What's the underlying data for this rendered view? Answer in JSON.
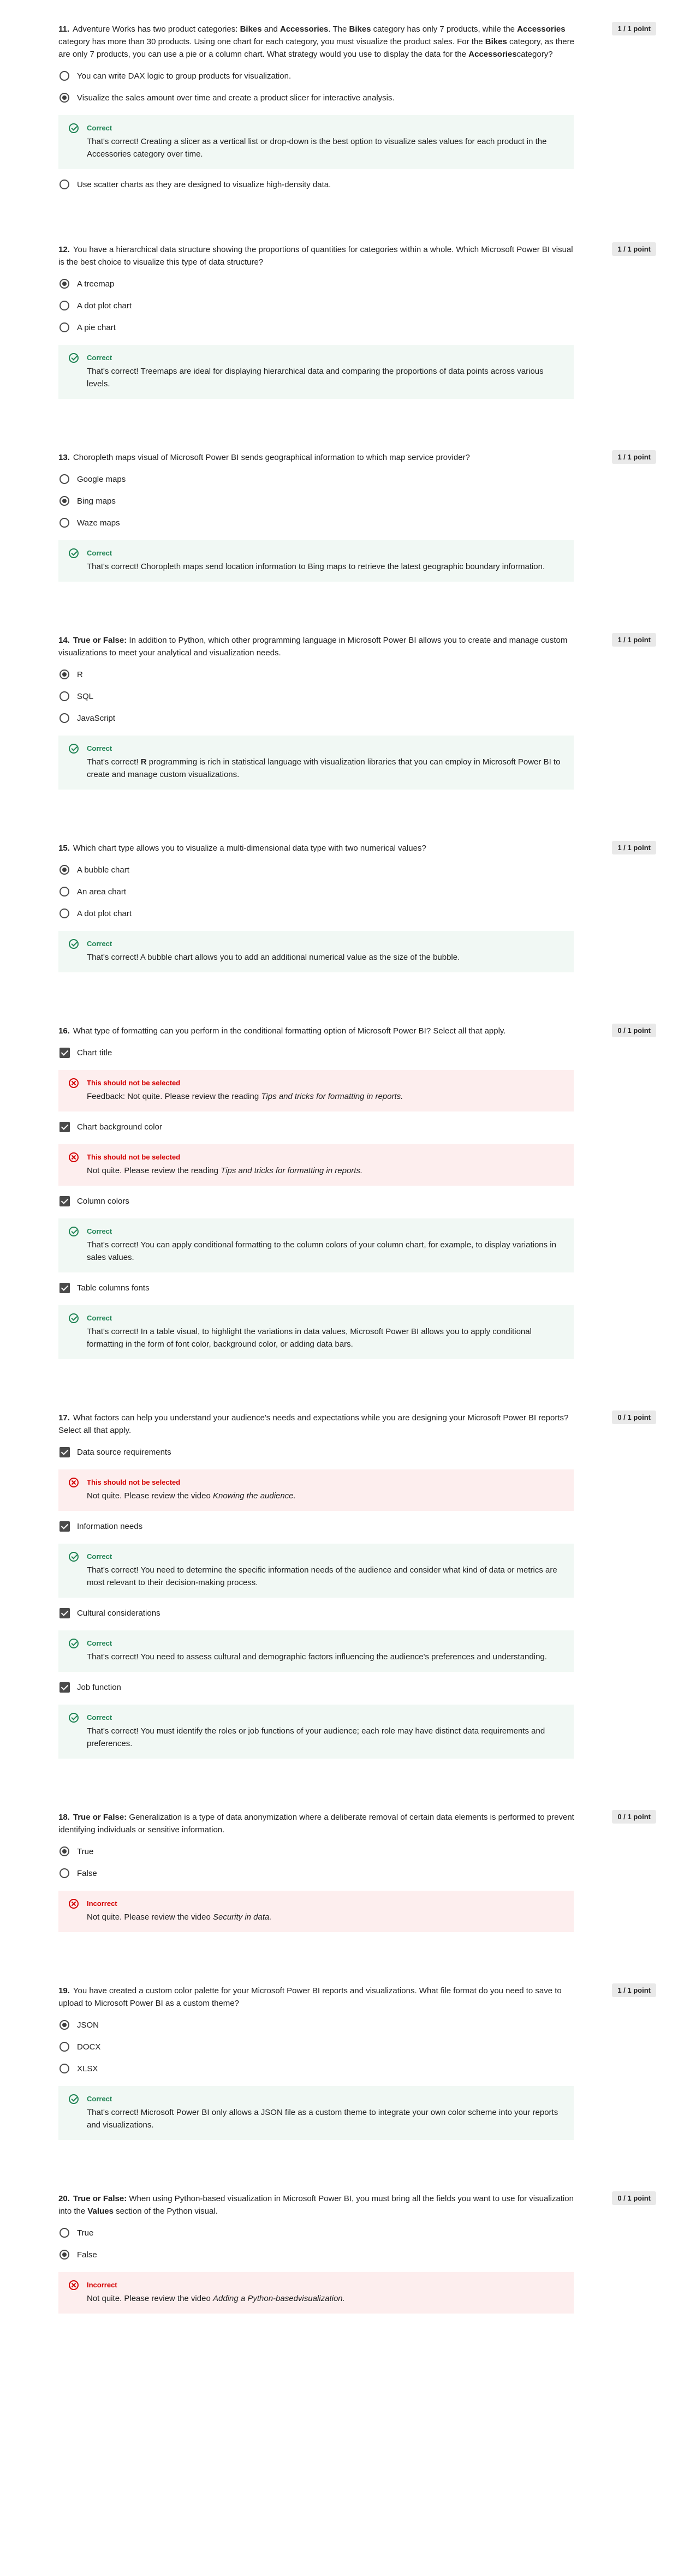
{
  "questions": [
    {
      "number": "11.",
      "points": "1 / 1 point",
      "text_html": "Adventure Works has two product categories: <b>Bikes</b> and <b>Accessories</b>. The <b>Bikes</b> category has only 7 products, while the <b>Accessories</b> category has more than 30 products. Using one chart for each category, you must visualize the product sales. For the <b>Bikes</b> category, as there are only 7 products, you can use a pie or a column chart. What strategy would you use to display the data for the <b>Accessories</b>category?",
      "type": "radio",
      "options": [
        {
          "label": "You can write DAX logic to group products for visualization.",
          "selected": false
        },
        {
          "label": "Visualize the sales amount over time and create a product slicer for interactive analysis.",
          "selected": true,
          "feedback": {
            "kind": "ok",
            "title": "Correct",
            "text_html": "That's correct! Creating a slicer as a vertical list or drop-down is the best option to visualize sales values for each product in the Accessories category over time."
          }
        },
        {
          "label": "Use scatter charts as they are designed to visualize high-density data.",
          "selected": false
        }
      ]
    },
    {
      "number": "12.",
      "points": "1 / 1 point",
      "text_html": "You have a hierarchical data structure showing the proportions of quantities for categories within a whole. Which Microsoft Power BI visual is the best choice to visualize this type of data structure?",
      "type": "radio",
      "options": [
        {
          "label": "A treemap",
          "selected": true
        },
        {
          "label": "A dot plot chart",
          "selected": false
        },
        {
          "label": "A pie chart",
          "selected": false,
          "feedback": {
            "kind": "ok",
            "title": "Correct",
            "text_html": "That's correct! Treemaps are ideal for displaying hierarchical data and comparing the proportions of data points across various levels."
          }
        }
      ]
    },
    {
      "number": "13.",
      "points": "1 / 1 point",
      "text_html": "Choropleth maps visual of Microsoft Power BI sends geographical information to which map service provider?",
      "type": "radio",
      "options": [
        {
          "label": "Google maps",
          "selected": false
        },
        {
          "label": "Bing maps",
          "selected": true
        },
        {
          "label": "Waze maps",
          "selected": false,
          "feedback": {
            "kind": "ok",
            "title": "Correct",
            "text_html": "That's correct! Choropleth maps send location information to Bing maps to retrieve the latest geographic boundary information."
          }
        }
      ]
    },
    {
      "number": "14.",
      "points": "1 / 1 point",
      "text_html": "<b>True or False:</b> In addition to Python, which other programming language in Microsoft Power BI allows you to create and manage custom visualizations to meet your analytical and visualization needs.",
      "type": "radio",
      "options": [
        {
          "label": "R",
          "selected": true
        },
        {
          "label": "SQL",
          "selected": false
        },
        {
          "label": "JavaScript",
          "selected": false,
          "feedback": {
            "kind": "ok",
            "title": "Correct",
            "text_html": "That's correct! <b>R</b> programming is rich in statistical language with visualization libraries that you can employ in Microsoft Power BI to create and manage custom visualizations."
          }
        }
      ]
    },
    {
      "number": "15.",
      "points": "1 / 1 point",
      "text_html": "Which chart type allows you to visualize a multi-dimensional data type with two numerical values?",
      "type": "radio",
      "options": [
        {
          "label": "A bubble chart",
          "selected": true
        },
        {
          "label": "An area chart",
          "selected": false
        },
        {
          "label": "A dot plot chart",
          "selected": false,
          "feedback": {
            "kind": "ok",
            "title": "Correct",
            "text_html": "That's correct! A bubble chart allows you to add an additional numerical value as the size of the bubble."
          }
        }
      ]
    },
    {
      "number": "16.",
      "points": "0 / 1 point",
      "text_html": "What type of formatting can you perform in the conditional formatting option of Microsoft Power BI? Select all that apply.",
      "type": "check",
      "options": [
        {
          "label": "Chart title",
          "selected": true,
          "feedback": {
            "kind": "bad",
            "title": "This should not be selected",
            "text_html": "Feedback: Not quite. Please review the reading <i>Tips and tricks for formatting in reports.</i>"
          }
        },
        {
          "label": "Chart background color",
          "selected": true,
          "feedback": {
            "kind": "bad",
            "title": "This should not be selected",
            "text_html": "Not quite. Please review the reading <i>Tips and tricks for formatting in reports.</i>"
          }
        },
        {
          "label": "Column colors",
          "selected": true,
          "feedback": {
            "kind": "ok",
            "title": "Correct",
            "text_html": "That's correct! You can apply conditional formatting to the column colors of your column chart, for example, to display variations in sales values."
          }
        },
        {
          "label": "Table columns fonts",
          "selected": true,
          "feedback": {
            "kind": "ok",
            "title": "Correct",
            "text_html": "That's correct! In a table visual, to highlight the variations in data values, Microsoft Power BI allows you to apply conditional formatting in the form of font color, background color, or adding data bars."
          }
        }
      ]
    },
    {
      "number": "17.",
      "points": "0 / 1 point",
      "text_html": "What factors can help you understand your audience's needs and expectations while you are designing your Microsoft Power BI reports? Select all that apply.",
      "type": "check",
      "options": [
        {
          "label": "Data source requirements",
          "selected": true,
          "feedback": {
            "kind": "bad",
            "title": "This should not be selected",
            "text_html": "Not quite. Please review the video <i>Knowing the audience.</i>"
          }
        },
        {
          "label": "Information needs",
          "selected": true,
          "feedback": {
            "kind": "ok",
            "title": "Correct",
            "text_html": "That's correct! You need to determine the specific information needs of the audience and consider what kind of data or metrics are most relevant to their decision-making process."
          }
        },
        {
          "label": "Cultural considerations",
          "selected": true,
          "feedback": {
            "kind": "ok",
            "title": "Correct",
            "text_html": "That's correct! You need to assess cultural and demographic factors influencing the audience's preferences and understanding."
          }
        },
        {
          "label": "Job function",
          "selected": true,
          "feedback": {
            "kind": "ok",
            "title": "Correct",
            "text_html": "That's correct! You must identify the roles or job functions of your audience; each role may have distinct data requirements and preferences."
          }
        }
      ]
    },
    {
      "number": "18.",
      "points": "0 / 1 point",
      "text_html": "<b>True or False:</b> Generalization is a type of data anonymization where a deliberate removal of certain data elements is performed to prevent identifying individuals or sensitive information.",
      "type": "radio",
      "options": [
        {
          "label": "True",
          "selected": true
        },
        {
          "label": "False",
          "selected": false,
          "feedback": {
            "kind": "bad",
            "title": "Incorrect",
            "text_html": "Not quite. Please review the video <i>Security in data.</i>"
          }
        }
      ]
    },
    {
      "number": "19.",
      "points": "1 / 1 point",
      "text_html": "You have created a custom color palette for your Microsoft Power BI reports and visualizations. What file format do you need to save to upload to Microsoft Power BI as a custom theme?",
      "type": "radio",
      "options": [
        {
          "label": "JSON",
          "selected": true
        },
        {
          "label": "DOCX",
          "selected": false
        },
        {
          "label": "XLSX",
          "selected": false,
          "feedback": {
            "kind": "ok",
            "title": "Correct",
            "text_html": "That's correct! Microsoft Power BI only allows a JSON file as a custom theme to integrate your own color scheme into your reports and visualizations."
          }
        }
      ]
    },
    {
      "number": "20.",
      "points": "0 / 1 point",
      "text_html": "<b>True or False:</b> When using Python-based visualization in Microsoft Power BI, you must bring all the fields you want to use for visualization into the <b>Values</b> section of the Python visual.",
      "type": "radio",
      "options": [
        {
          "label": "True",
          "selected": false
        },
        {
          "label": "False",
          "selected": true,
          "feedback": {
            "kind": "bad",
            "title": "Incorrect",
            "text_html": "Not quite. Please review the video <i>Adding a Python-basedvisualization.</i>"
          }
        }
      ]
    }
  ]
}
